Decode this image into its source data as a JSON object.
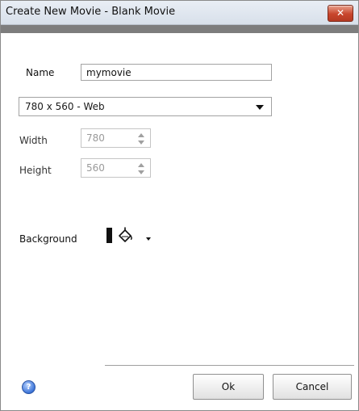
{
  "window": {
    "title": "Create New Movie - Blank Movie",
    "close_glyph": "✕"
  },
  "form": {
    "name_label": "Name",
    "name_value": "mymovie",
    "preset_value": "780 x 560 - Web",
    "width_label": "Width",
    "width_value": "780",
    "height_label": "Height",
    "height_value": "560",
    "background_label": "Background",
    "background_color": "#111111"
  },
  "footer": {
    "help_glyph": "?",
    "ok_label": "Ok",
    "cancel_label": "Cancel"
  }
}
